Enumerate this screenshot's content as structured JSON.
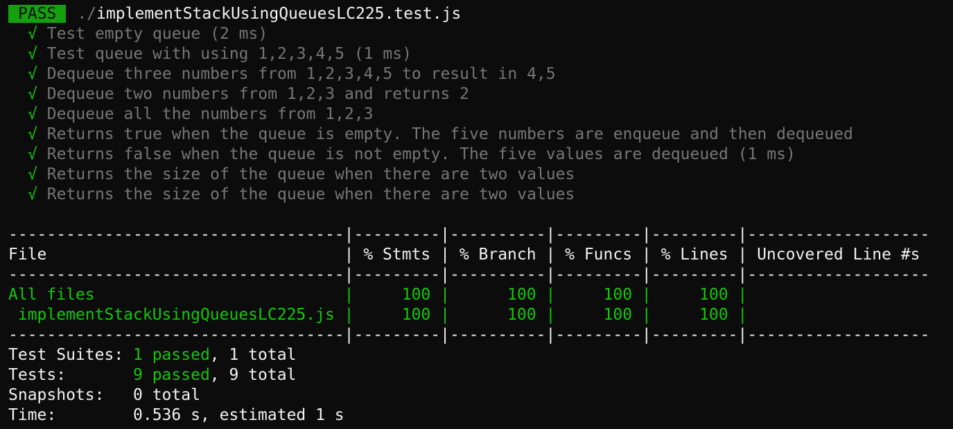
{
  "header": {
    "badge": "PASS",
    "path_prefix": "./",
    "path_file": "implementStackUsingQueuesLC225.test.js"
  },
  "tests": [
    {
      "mark": "√",
      "text": "Test empty queue (2 ms)"
    },
    {
      "mark": "√",
      "text": "Test queue with using 1,2,3,4,5 (1 ms)"
    },
    {
      "mark": "√",
      "text": "Dequeue three numbers from 1,2,3,4,5 to result in 4,5"
    },
    {
      "mark": "√",
      "text": "Dequeue two numbers from 1,2,3 and returns 2"
    },
    {
      "mark": "√",
      "text": "Dequeue all the numbers from 1,2,3"
    },
    {
      "mark": "√",
      "text": "Returns true when the queue is empty. The five numbers are enqueue and then dequeued"
    },
    {
      "mark": "√",
      "text": "Returns false when the queue is not empty. The five values are dequeued (1 ms)"
    },
    {
      "mark": "√",
      "text": "Returns the size of the queue when there are two values"
    },
    {
      "mark": "√",
      "text": "Returns the size of the queue when there are two values"
    }
  ],
  "coverage": {
    "separator": "-----------------------------------|---------|----------|---------|---------|-------------------",
    "header_row": "File                               | % Stmts | % Branch | % Funcs | % Lines | Uncovered Line #s ",
    "rows": [
      {
        "name": "All files                         ",
        "cells": " |     100 |      100 |     100 |     100 |                   "
      },
      {
        "name": " implementStackUsingQueuesLC225.js",
        "cells": " |     100 |      100 |     100 |     100 |                   "
      }
    ]
  },
  "summary": {
    "suites_label": "Test Suites: ",
    "suites_passed": "1 passed",
    "suites_total": ", 1 total",
    "tests_label": "Tests:       ",
    "tests_passed": "9 passed",
    "tests_total": ", 9 total",
    "snapshots_label": "Snapshots:   ",
    "snapshots_value": "0 total",
    "time_label": "Time:        ",
    "time_value": "0.536 s, estimated 1 s"
  }
}
